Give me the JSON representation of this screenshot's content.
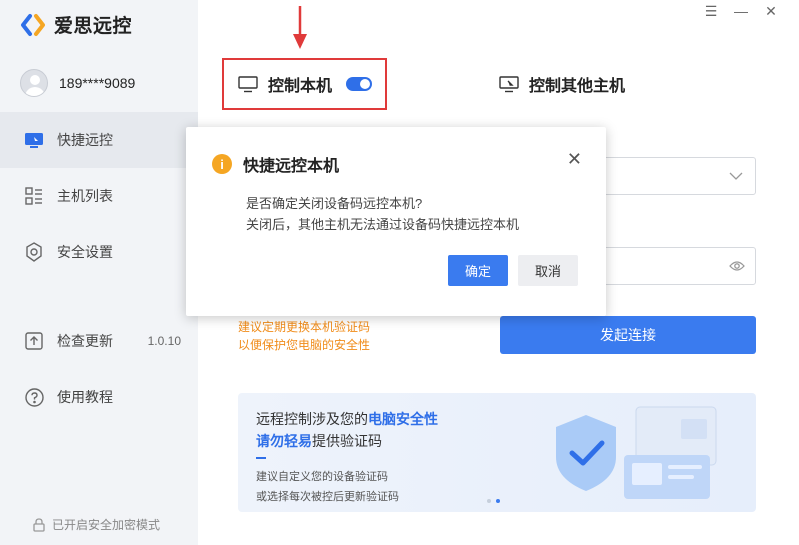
{
  "app": {
    "name": "爱思远控"
  },
  "window_controls": [
    "☰",
    "—",
    "✕"
  ],
  "user": {
    "phone": "189****9089"
  },
  "sidebar": {
    "items": [
      {
        "label": "快捷远控",
        "icon": "monitor-icon",
        "active": true
      },
      {
        "label": "主机列表",
        "icon": "list-icon",
        "active": false
      },
      {
        "label": "安全设置",
        "icon": "shield-icon",
        "active": false
      },
      {
        "label": "检查更新",
        "icon": "upload-icon",
        "version": "1.0.10"
      },
      {
        "label": "使用教程",
        "icon": "help-icon"
      }
    ],
    "footer": "已开启安全加密模式"
  },
  "tabs": {
    "local": {
      "label": "控制本机",
      "toggle_on": true
    },
    "other": {
      "label": "控制其他主机"
    }
  },
  "hint": {
    "line1": "建议定期更换本机验证码",
    "line2": "以便保护您电脑的安全性"
  },
  "connect_button": "发起连接",
  "banner": {
    "line1_prefix": "远程控制涉及您的",
    "line1_highlight": "电脑安全性",
    "line2_highlight": "请勿轻易",
    "line2_suffix": "提供验证码",
    "sub1": "建议自定义您的设备验证码",
    "sub2": "或选择每次被控后更新验证码",
    "slide_index": 2,
    "slide_count": 2
  },
  "dialog": {
    "title": "快捷远控本机",
    "message1": "是否确定关闭设备码远控本机?",
    "message2": "关闭后，其他主机无法通过设备码快捷远控本机",
    "ok": "确定",
    "cancel": "取消"
  },
  "colors": {
    "accent": "#3a7bef",
    "warning": "#f5a623",
    "highlight_border": "#e03a3a",
    "hint": "#f08c1a"
  }
}
